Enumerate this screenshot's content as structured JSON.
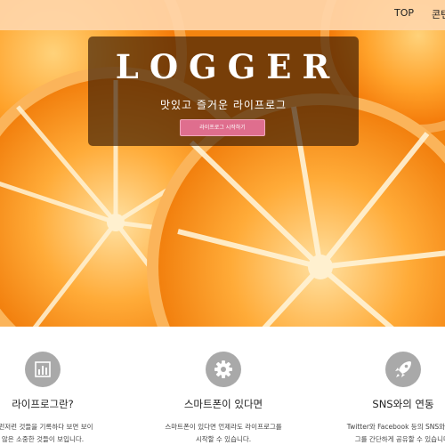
{
  "nav": {
    "items": [
      {
        "label": "TOP"
      },
      {
        "label": "콘텐"
      }
    ]
  },
  "hero": {
    "title": "LOGGER",
    "subtitle": "맛있고 즐거운 라이프로그",
    "button_label": "라이프로그 시작하기"
  },
  "features": [
    {
      "icon": "bar-chart-icon",
      "title": "라이프로그란?",
      "desc_lines": [
        "이런저런 것들을 기록하다 보면 보이",
        "않은 소중한 것들이 보입니다."
      ]
    },
    {
      "icon": "gear-icon",
      "title": "스마트폰이 있다면",
      "desc_lines": [
        "스마트폰이 있다면 언제라도 라이프로그를",
        "시작할 수 있습니다."
      ]
    },
    {
      "icon": "rocket-icon",
      "title": "SNS와의 연동",
      "desc_lines": [
        "Twitter와 Facebook 등의 SNS와 연동",
        "그를 간단하게 공유할 수 있습니다."
      ]
    }
  ],
  "colors": {
    "hero_orange": "#f58a12",
    "button_pink": "#df6e8e",
    "icon_gray": "#a9a9a9"
  }
}
